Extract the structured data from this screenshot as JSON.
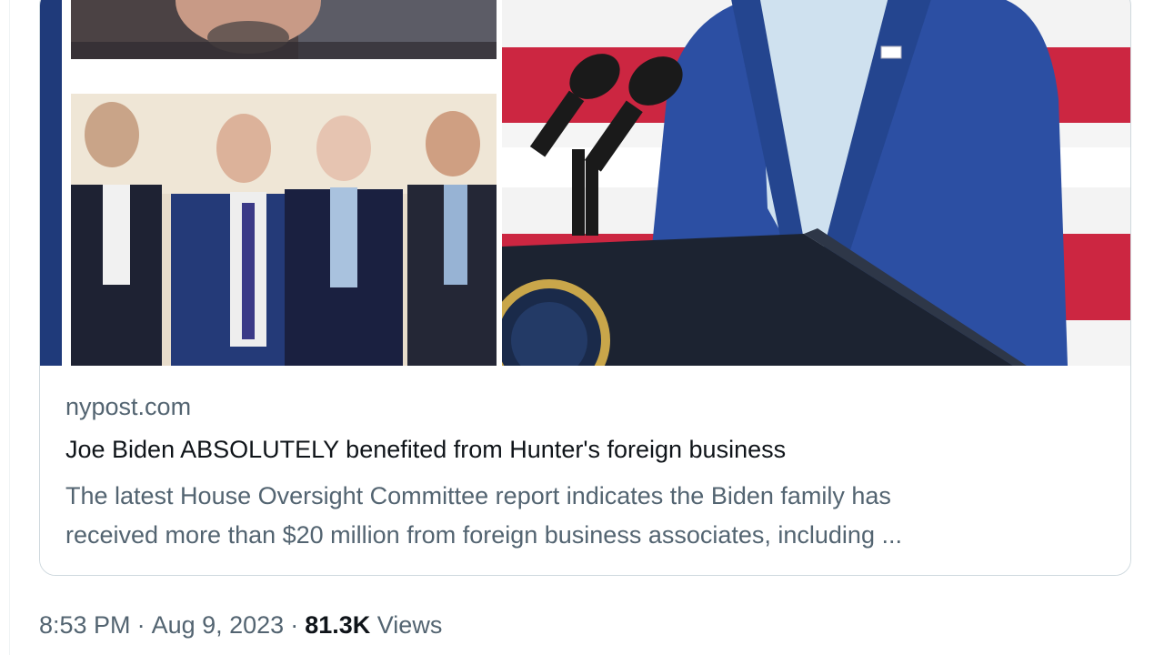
{
  "link_card": {
    "domain": "nypost.com",
    "headline": "Joe Biden ABSOLUTELY benefited from Hunter's foreign business",
    "description_line1": "The latest House Oversight Committee report indicates the Biden family has",
    "description_line2": "received more than $20 million from foreign business associates, including ..."
  },
  "tweet_meta": {
    "time": "8:53 PM",
    "separator": "·",
    "date": "Aug 9, 2023",
    "views_count": "81.3K",
    "views_label": "Views"
  },
  "colors": {
    "flag_red": "#c8102e",
    "flag_blue": "#1f3a7a",
    "suit_blue": "#2c4fa3",
    "text_primary": "#0f1419",
    "text_secondary": "#536471",
    "border": "#cfd9de"
  }
}
